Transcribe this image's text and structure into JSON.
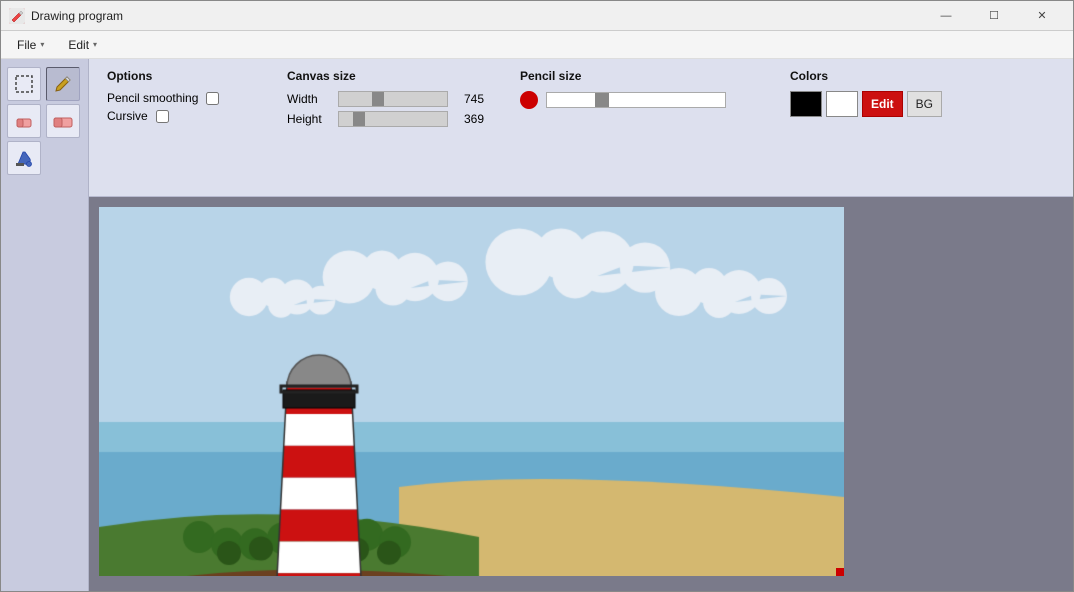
{
  "app": {
    "title": "Drawing program",
    "icon": "✏"
  },
  "titlebar": {
    "minimize_label": "—",
    "maximize_label": "☐",
    "close_label": "✕"
  },
  "menubar": {
    "items": [
      {
        "label": "File",
        "id": "file"
      },
      {
        "label": "Edit",
        "id": "edit"
      }
    ]
  },
  "tools": [
    {
      "id": "select",
      "icon": "▦",
      "label": "Select",
      "active": false
    },
    {
      "id": "pencil",
      "icon": "✏",
      "label": "Pencil",
      "active": true
    },
    {
      "id": "eraser1",
      "icon": "◻",
      "label": "Eraser small",
      "active": false
    },
    {
      "id": "eraser2",
      "icon": "◻",
      "label": "Eraser large",
      "active": false
    },
    {
      "id": "fill",
      "icon": "◆",
      "label": "Fill",
      "active": false
    }
  ],
  "options": {
    "title": "Options",
    "pencil_smoothing_label": "Pencil smoothing",
    "pencil_smoothing_checked": false,
    "cursive_label": "Cursive",
    "cursive_checked": false
  },
  "canvas_size": {
    "title": "Canvas size",
    "width_label": "Width",
    "width_value": 745,
    "width_slider": 66,
    "height_label": "Height",
    "height_value": 369,
    "height_slider": 48
  },
  "pencil_size": {
    "title": "Pencil size",
    "slider_value": 30
  },
  "colors": {
    "title": "Colors",
    "primary_color": "#000000",
    "secondary_color": "#ffffff",
    "edit_label": "Edit",
    "bg_label": "BG"
  }
}
